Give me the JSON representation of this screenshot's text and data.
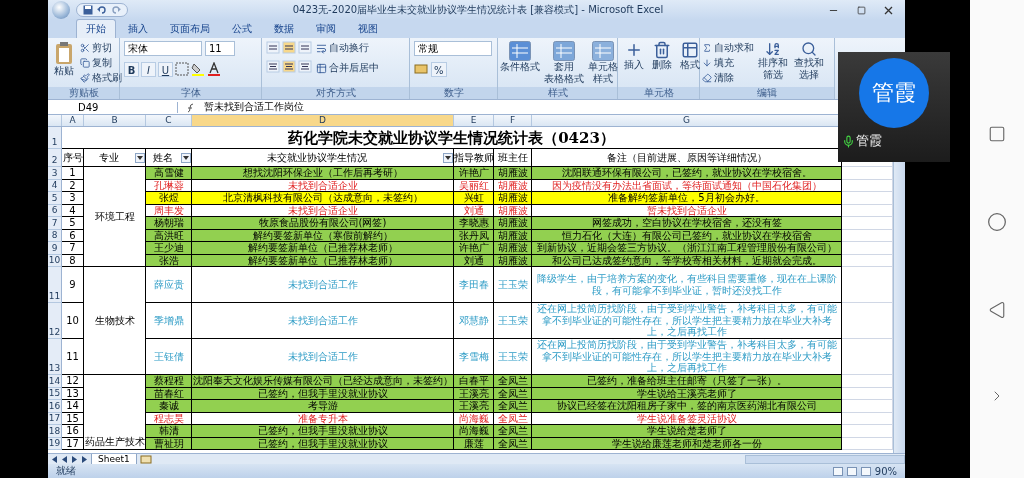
{
  "window": {
    "title": "0423无-2020届毕业生未交就业协议学生情况统计表  [兼容模式] - Microsoft Excel"
  },
  "tabs": [
    {
      "label": "开始",
      "selected": true
    },
    {
      "label": "插入",
      "selected": false
    },
    {
      "label": "页面布局",
      "selected": false
    },
    {
      "label": "公式",
      "selected": false
    },
    {
      "label": "数据",
      "selected": false
    },
    {
      "label": "审阅",
      "selected": false
    },
    {
      "label": "视图",
      "selected": false
    }
  ],
  "ribbon": {
    "clipboard": {
      "label": "剪贴板",
      "paste": "粘贴",
      "items": [
        "剪切",
        "复制",
        "格式刷"
      ]
    },
    "font": {
      "label": "字体",
      "font_name": "宋体",
      "font_size": "11",
      "styles": [
        "B",
        "I",
        "U"
      ]
    },
    "alignment": {
      "label": "对齐方式",
      "items": [
        "自动换行",
        "合并后居中"
      ]
    },
    "number": {
      "label": "数字",
      "format": "常规",
      "percent": "%"
    },
    "styles": {
      "label": "样式",
      "items": [
        [
          "条件格式"
        ],
        [
          "套用",
          "表格格式"
        ],
        [
          "单元格",
          "样式"
        ]
      ]
    },
    "cells": {
      "label": "单元格",
      "items": [
        "插入",
        "删除",
        "格式"
      ]
    },
    "editing": {
      "label": "编辑",
      "items": [
        "自动求和",
        "填充",
        "清除"
      ],
      "big": [
        [
          "排序和",
          "筛选"
        ],
        [
          "查找和",
          "选择"
        ]
      ]
    }
  },
  "formula_bar": {
    "cell_ref": "D49",
    "formula": "暂未找到合适工作岗位"
  },
  "columns": [
    "A",
    "B",
    "C",
    "D",
    "E",
    "F",
    "G"
  ],
  "sheet": {
    "title_row": "1",
    "title": "药化学院未交就业协议学生情况统计表（0423）",
    "header_row": "2",
    "headers": [
      {
        "label": "序号",
        "filter": false
      },
      {
        "label": "专业",
        "filter": true
      },
      {
        "label": "姓名",
        "filter": true
      },
      {
        "label": "未交就业协议学生情况",
        "filter": true
      },
      {
        "label": "指导教师",
        "filter": false
      },
      {
        "label": "班主任",
        "filter": false
      },
      {
        "label": "备注（目前进展、原因等详细情况）",
        "filter": false
      }
    ],
    "groups": [
      {
        "major": "环境工程",
        "label_at_bottom": false,
        "rows": [
          {
            "row": "3",
            "no": "1",
            "name": "高雪健",
            "status": "想找沈阳环保企业（工作后再考研）",
            "advisor": "许艳广",
            "head": "胡雁波",
            "note": "沈阳联通环保有限公司，已签约，就业协议在学校宿舍。",
            "kind": "signed",
            "tall": false
          },
          {
            "row": "4",
            "no": "2",
            "name": "孔琳蓉",
            "status": "未找到合适企业",
            "advisor": "吴丽红",
            "head": "胡雁波",
            "note": "因为疫情没有办法出省面试，等待面试通知（中国石化集团）",
            "kind": "unplaced",
            "tall": false
          },
          {
            "row": "5",
            "no": "3",
            "name": "张煜",
            "status": "北京清枫科技有限公司（达成意向，未签约）",
            "advisor": "兴虹",
            "head": "胡雁波",
            "note": "准备解约签新单位，5月初会办好。",
            "kind": "intent",
            "tall": false
          },
          {
            "row": "6",
            "no": "4",
            "name": "周丰发",
            "status": "未找到合适企业",
            "advisor": "刘通",
            "head": "胡雁波",
            "note": "暂未找到合适企业",
            "kind": "unplaced",
            "tall": false
          },
          {
            "row": "7",
            "no": "5",
            "name": "杨朝瑞",
            "status": "牧原食品股份有限公司(网签)",
            "advisor": "李晓惠",
            "head": "胡雁波",
            "note": "网签成功，空白协议在学校宿舍，还没有签",
            "kind": "signed",
            "tall": false
          },
          {
            "row": "8",
            "no": "6",
            "name": "高洪旺",
            "status": "解约要签新单位（寒假前解约）",
            "advisor": "张丹凤",
            "head": "胡雁波",
            "note": "恒力石化（大连）有限公司已签约，就业协议在学校宿舍",
            "kind": "signed",
            "tall": false
          },
          {
            "row": "9",
            "no": "7",
            "name": "王少迪",
            "status": "解约要签新单位（已推荐林老师）",
            "advisor": "许艳广",
            "head": "胡雁波",
            "note": "到新协议，近期会签三方协议。（浙江江南工程管理股份有限公司）",
            "kind": "signed",
            "tall": false
          },
          {
            "row": "10",
            "no": "8",
            "name": "张浩",
            "status": "解约要签新单位（已推荐林老师）",
            "advisor": "刘通",
            "head": "胡雁波",
            "note": "和公司已达成签约意向，等学校寄相关材料，近期就会完成。",
            "kind": "signed",
            "tall": false
          }
        ]
      },
      {
        "major": "生物技术",
        "label_at_bottom": false,
        "rows": [
          {
            "row": "11",
            "no": "9",
            "name": "薛应贵",
            "status": "未找到合适工作",
            "advisor": "李田春",
            "head": "王玉荣",
            "note": "降级学生，由于培养方案的变化，有些科目需要重修，现在在上课阶段，有可能拿不到毕业证，暂时还没找工作",
            "kind": "retake",
            "tall": true
          },
          {
            "row": "12",
            "no": "10",
            "name": "季增鼎",
            "status": "未找到合适工作",
            "advisor": "邓慧静",
            "head": "王玉荣",
            "note": "还在网上投简历找阶段，由于受到学业警告，补考科目太多，有可能拿不到毕业证的可能性存在，所以学生把主要精力放在毕业大补考上，之后再找工作",
            "kind": "retake",
            "tall": true
          },
          {
            "row": "13",
            "no": "11",
            "name": "王钰倩",
            "status": "未找到合适工作",
            "advisor": "李雪梅",
            "head": "王玉荣",
            "note": "还在网上投简历找阶段，由于受到学业警告，补考科目太多，有可能拿不到毕业证的可能性存在，所以学生把主要精力放在毕业大补考上，之后再找工作",
            "kind": "retake",
            "tall": true
          }
        ]
      },
      {
        "major": "药品生产技术",
        "label_at_bottom": true,
        "rows": [
          {
            "row": "14",
            "no": "12",
            "name": "蔡程程",
            "status": "沈阳奉天文化娱乐传媒有限公司（已经达成意向，未签约）",
            "advisor": "白春平",
            "head": "全凤兰",
            "note": "已签约，准备给班主任邮寄（只签了一张）。",
            "kind": "signed",
            "tall": false
          },
          {
            "row": "15",
            "no": "13",
            "name": "苗春红",
            "status": "已签约，但我手里没就业协议",
            "advisor": "王溪亮",
            "head": "全凤兰",
            "note": "学生说给王溪亮老师了",
            "kind": "signed",
            "tall": false
          },
          {
            "row": "16",
            "no": "14",
            "name": "秦诚",
            "status": "考导游",
            "advisor": "王溪亮",
            "head": "全凤兰",
            "note": "协议已经签在沈阳租房子家中，签的南京医药湖北有限公司",
            "kind": "signed",
            "tall": false
          },
          {
            "row": "17",
            "no": "15",
            "name": "程志昊",
            "status": "准备专升本",
            "advisor": "尚海巍",
            "head": "全凤兰",
            "note": "学生说准备签灵活协议",
            "kind": "unplaced",
            "tall": false
          },
          {
            "row": "18",
            "no": "16",
            "name": "韩清",
            "status": "已签约，但我手里没就业协议",
            "advisor": "尚海巍",
            "head": "全凤兰",
            "note": "学生说给楚老师了",
            "kind": "signed",
            "tall": false
          },
          {
            "row": "19",
            "no": "17",
            "name": "曹祉玥",
            "status": "已签约，但我手里没就业协议",
            "advisor": "廉莲",
            "head": "全凤兰",
            "note": "学生说给廉莲老师和楚老师各一份",
            "kind": "signed",
            "tall": false
          }
        ]
      }
    ]
  },
  "sheet_tabs": [
    {
      "label": "Sheet1",
      "selected": true
    }
  ],
  "status_bar": {
    "status": "就绪",
    "zoom": "90%"
  },
  "call_overlay": {
    "avatar": "管霞",
    "name": "管霞"
  }
}
